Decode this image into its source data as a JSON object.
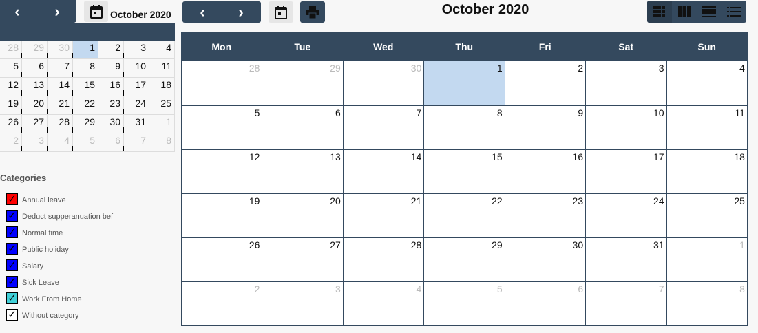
{
  "mini": {
    "title": "October 2020",
    "weeks": [
      [
        {
          "d": "28",
          "o": true
        },
        {
          "d": "29",
          "o": true
        },
        {
          "d": "30",
          "o": true
        },
        {
          "d": "1",
          "t": true
        },
        {
          "d": "2"
        },
        {
          "d": "3"
        },
        {
          "d": "4"
        }
      ],
      [
        {
          "d": "5"
        },
        {
          "d": "6"
        },
        {
          "d": "7"
        },
        {
          "d": "8"
        },
        {
          "d": "9"
        },
        {
          "d": "10"
        },
        {
          "d": "11"
        }
      ],
      [
        {
          "d": "12"
        },
        {
          "d": "13"
        },
        {
          "d": "14"
        },
        {
          "d": "15"
        },
        {
          "d": "16"
        },
        {
          "d": "17"
        },
        {
          "d": "18"
        }
      ],
      [
        {
          "d": "19"
        },
        {
          "d": "20"
        },
        {
          "d": "21"
        },
        {
          "d": "22"
        },
        {
          "d": "23"
        },
        {
          "d": "24"
        },
        {
          "d": "25"
        }
      ],
      [
        {
          "d": "26"
        },
        {
          "d": "27"
        },
        {
          "d": "28"
        },
        {
          "d": "29"
        },
        {
          "d": "30"
        },
        {
          "d": "31"
        },
        {
          "d": "1",
          "o": true
        }
      ],
      [
        {
          "d": "2",
          "o": true
        },
        {
          "d": "3",
          "o": true
        },
        {
          "d": "4",
          "o": true
        },
        {
          "d": "5",
          "o": true
        },
        {
          "d": "6",
          "o": true
        },
        {
          "d": "7",
          "o": true
        },
        {
          "d": "8",
          "o": true
        }
      ]
    ]
  },
  "categories": {
    "title": "Categories",
    "items": [
      {
        "label": "Annual leave",
        "color": "#ff0000",
        "checked": true
      },
      {
        "label": "Deduct supperanuation bef",
        "color": "#0000ff",
        "checked": true
      },
      {
        "label": "Normal time",
        "color": "#0000ff",
        "checked": true
      },
      {
        "label": "Public holiday",
        "color": "#0000ff",
        "checked": true
      },
      {
        "label": "Salary",
        "color": "#0000ff",
        "checked": true
      },
      {
        "label": "Sick Leave",
        "color": "#0000ff",
        "checked": true
      },
      {
        "label": "Work From Home",
        "color": "#40d0d8",
        "checked": true
      },
      {
        "label": "Without category",
        "color": "#ffffff",
        "checked": true
      }
    ]
  },
  "main": {
    "title": "October 2020",
    "weekdays": [
      "Mon",
      "Tue",
      "Wed",
      "Thu",
      "Fri",
      "Sat",
      "Sun"
    ],
    "weeks": [
      [
        {
          "d": "28",
          "o": true
        },
        {
          "d": "29",
          "o": true
        },
        {
          "d": "30",
          "o": true
        },
        {
          "d": "1",
          "t": true
        },
        {
          "d": "2"
        },
        {
          "d": "3"
        },
        {
          "d": "4"
        }
      ],
      [
        {
          "d": "5"
        },
        {
          "d": "6"
        },
        {
          "d": "7"
        },
        {
          "d": "8"
        },
        {
          "d": "9"
        },
        {
          "d": "10"
        },
        {
          "d": "11"
        }
      ],
      [
        {
          "d": "12"
        },
        {
          "d": "13"
        },
        {
          "d": "14"
        },
        {
          "d": "15"
        },
        {
          "d": "16"
        },
        {
          "d": "17"
        },
        {
          "d": "18"
        }
      ],
      [
        {
          "d": "19"
        },
        {
          "d": "20"
        },
        {
          "d": "21"
        },
        {
          "d": "22"
        },
        {
          "d": "23"
        },
        {
          "d": "24"
        },
        {
          "d": "25"
        }
      ],
      [
        {
          "d": "26"
        },
        {
          "d": "27"
        },
        {
          "d": "28"
        },
        {
          "d": "29"
        },
        {
          "d": "30"
        },
        {
          "d": "31"
        },
        {
          "d": "1",
          "o": true
        }
      ],
      [
        {
          "d": "2",
          "o": true
        },
        {
          "d": "3",
          "o": true
        },
        {
          "d": "4",
          "o": true
        },
        {
          "d": "5",
          "o": true
        },
        {
          "d": "6",
          "o": true
        },
        {
          "d": "7",
          "o": true
        },
        {
          "d": "8",
          "o": true
        }
      ]
    ]
  },
  "icons": {
    "prev": "chevron-left-icon",
    "next": "chevron-right-icon",
    "today": "calendar-icon",
    "print": "printer-icon",
    "month": "month-view-icon",
    "week": "week-view-icon",
    "day": "day-view-icon",
    "list": "list-view-icon"
  },
  "colors": {
    "accent": "#34495e",
    "today": "#c3d9f0",
    "other_day": "#bbbbbb"
  }
}
